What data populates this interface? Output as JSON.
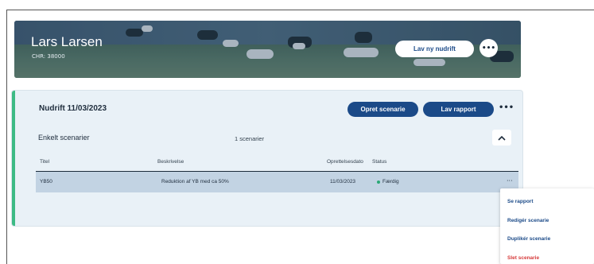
{
  "header": {
    "farmer_name": "Lars Larsen",
    "chr_label": "CHR: 38000",
    "new_nudrift_button": "Lav ny nudrift",
    "more_icon": "ellipsis-icon"
  },
  "nudrift": {
    "title": "Nudrift 11/03/2023",
    "create_scenario_button": "Opret scenarie",
    "make_report_button": "Lav rapport",
    "more_icon": "ellipsis-icon",
    "section": {
      "title": "Enkelt scenarier",
      "count": "1 scenarier",
      "toggle_icon": "chevron-up-icon"
    },
    "table": {
      "columns": [
        "Titel",
        "Beskrivelse",
        "Oprettelsesdato",
        "Status"
      ],
      "rows": [
        {
          "title": "YB50",
          "description": "Reduktion af YB med ca 50%",
          "date": "11/03/2023",
          "status": "Færdig"
        }
      ]
    }
  },
  "context_menu": {
    "items": [
      "Se rapport",
      "Redigér scenarie",
      "Duplikér scenarie",
      "Slet scenarie"
    ]
  },
  "colors": {
    "primary": "#1b4a88",
    "accent_green": "#3dbb85",
    "danger": "#d63a3a",
    "card_bg": "#e9f1f7",
    "row_selected": "#c2d3e3"
  }
}
